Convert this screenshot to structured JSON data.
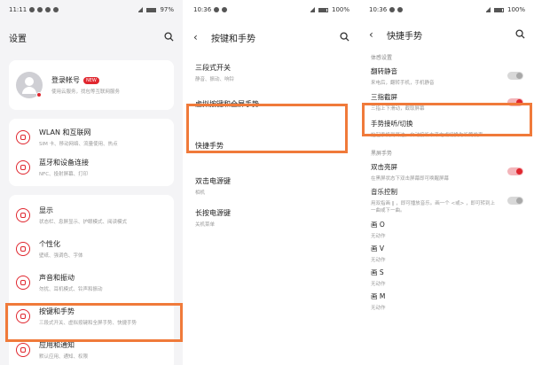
{
  "panel1": {
    "status": {
      "time": "11:11",
      "battery": "97%"
    },
    "title": "设置",
    "account": {
      "name": "登录帐号",
      "badge": "NEW",
      "desc": "使用云服务，找包等互联网服务"
    },
    "group1": [
      {
        "label": "WLAN 和互联网",
        "desc": "SIM 卡、移动网络、流量使用、热点",
        "icon": "wifi-icon"
      },
      {
        "label": "蓝牙和设备连接",
        "desc": "NFC、投射屏幕、打印",
        "icon": "bluetooth-icon"
      }
    ],
    "group2": [
      {
        "label": "显示",
        "desc": "状态栏、息屏显示、护眼模式、阅读模式",
        "icon": "display-icon"
      },
      {
        "label": "个性化",
        "desc": "壁纸、强调色、字体",
        "icon": "palette-icon"
      },
      {
        "label": "声音和振动",
        "desc": "勿扰、耳机模式、铃声和振动",
        "icon": "sound-icon"
      },
      {
        "label": "按键和手势",
        "desc": "三段式开关、虚拟按键和全屏手势、快捷手势",
        "icon": "gesture-icon"
      },
      {
        "label": "应用和通知",
        "desc": "默认应用、通知、权限",
        "icon": "apps-icon"
      }
    ]
  },
  "panel2": {
    "status": {
      "time": "10:36",
      "battery": "100%"
    },
    "title": "按键和手势",
    "items": [
      {
        "label": "三段式开关",
        "desc": "静音、振动、响铃"
      },
      {
        "label": "虚拟按键和全屏手势",
        "desc": ""
      },
      {
        "label": "快捷手势",
        "desc": ""
      },
      {
        "label": "双击电源键",
        "desc": "相机"
      },
      {
        "label": "长按电源键",
        "desc": "关机菜单"
      }
    ]
  },
  "panel3": {
    "status": {
      "time": "10:36",
      "battery": "100%"
    },
    "title": "快捷手势",
    "section1": "体感设置",
    "rows1": [
      {
        "label": "翻转静音",
        "desc": "来电后，翻转手机，手机静音",
        "toggle": "off"
      },
      {
        "label": "三指截屏",
        "desc": "三指上下滑动，截取屏幕",
        "toggle": "on"
      },
      {
        "label": "手势接听/切换",
        "desc": "抬起手机到耳边，自动接听未来电或切换为听筒发声",
        "toggle": "none"
      }
    ],
    "section2": "黑屏手势",
    "rows2": [
      {
        "label": "双击亮屏",
        "desc": "在黑屏状态下双击屏幕即可唤醒屏幕",
        "toggle": "on"
      },
      {
        "label": "音乐控制",
        "desc": "用双指画 ‖ ，即可播放音乐。画一个 <或> ，即可转到上一曲或下一曲。",
        "toggle": "off"
      },
      {
        "label": "画 O",
        "desc": "无动作",
        "toggle": "none"
      },
      {
        "label": "画 V",
        "desc": "无动作",
        "toggle": "none"
      },
      {
        "label": "画 S",
        "desc": "无动作",
        "toggle": "none"
      },
      {
        "label": "画 M",
        "desc": "无动作",
        "toggle": "none"
      }
    ]
  },
  "highlight_color": "#f07a3a",
  "accent_color": "#e0262e"
}
